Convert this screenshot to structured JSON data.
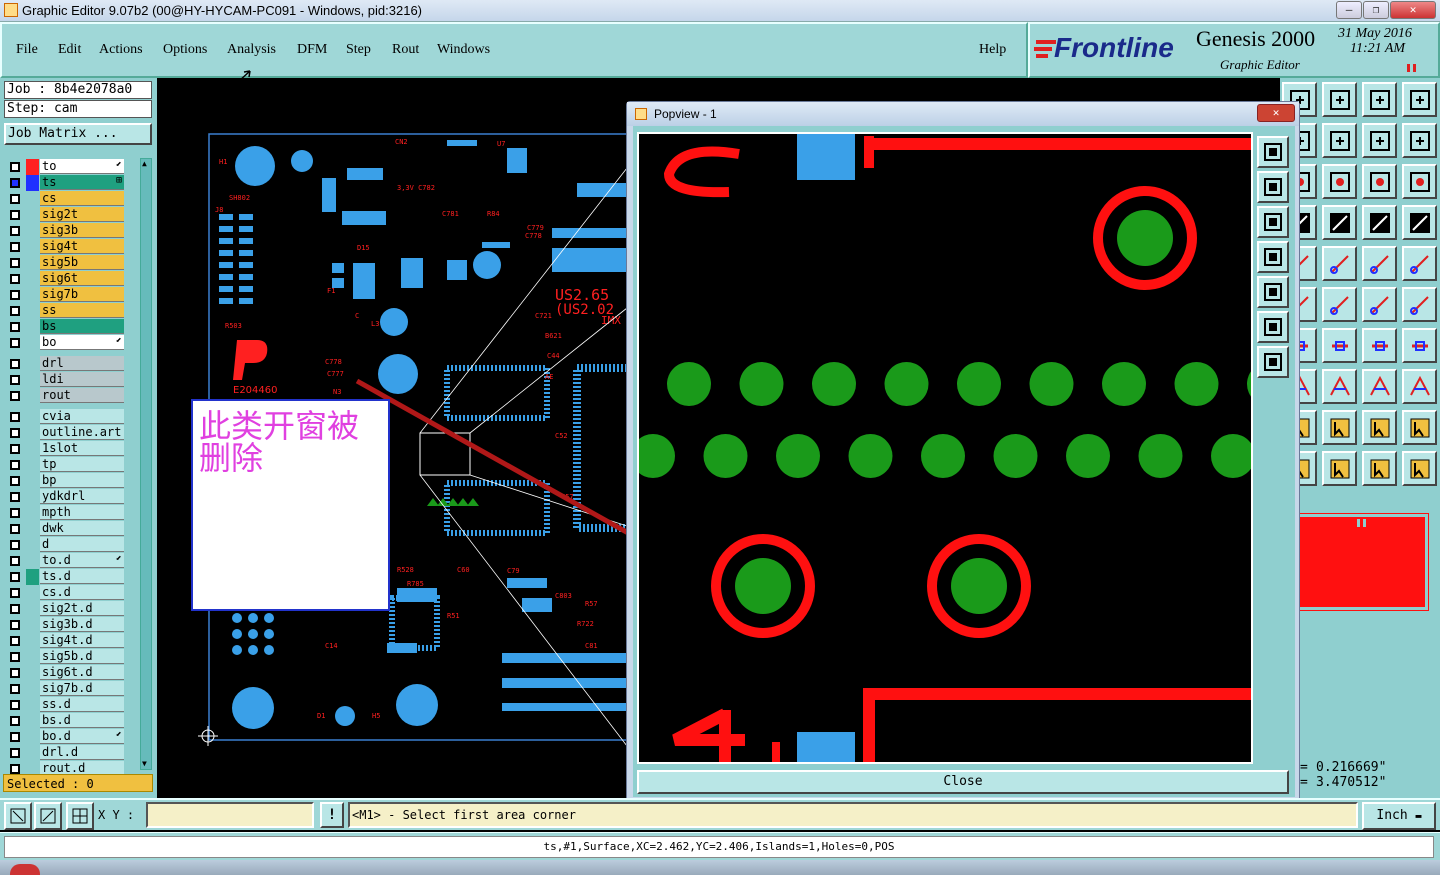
{
  "window": {
    "title": "Graphic Editor 9.07b2 (00@HY-HYCAM-PC091 - Windows, pid:3216)",
    "buttons": [
      "—",
      "❐",
      "✕"
    ]
  },
  "menu": {
    "items": [
      "File",
      "Edit",
      "Actions",
      "Options",
      "Analysis",
      "DFM",
      "Step",
      "Rout",
      "Windows"
    ],
    "help": "Help"
  },
  "brand": {
    "logo": "Frontline",
    "product": "Genesis 2000",
    "subtitle": "Graphic Editor",
    "date": "31 May 2016",
    "time": "11:21 AM"
  },
  "job": {
    "job_label": "Job : 8b4e2078a0",
    "step_label": "Step: cam",
    "matrix_button": "Job Matrix ..."
  },
  "layers_group1": [
    {
      "name": "to",
      "swatch": "#ff2020",
      "bg": "#ffffff",
      "mark": "⬋"
    },
    {
      "name": "ts",
      "swatch": "#2030ff",
      "bg": "#1fa080",
      "mark": "⊞",
      "active": true
    },
    {
      "name": "cs",
      "swatch": "#8fcfcf",
      "bg": "#f0c040"
    },
    {
      "name": "sig2t",
      "swatch": "#8fcfcf",
      "bg": "#f0c040"
    },
    {
      "name": "sig3b",
      "swatch": "#8fcfcf",
      "bg": "#f0c040"
    },
    {
      "name": "sig4t",
      "swatch": "#8fcfcf",
      "bg": "#f0c040"
    },
    {
      "name": "sig5b",
      "swatch": "#8fcfcf",
      "bg": "#f0c040"
    },
    {
      "name": "sig6t",
      "swatch": "#8fcfcf",
      "bg": "#f0c040"
    },
    {
      "name": "sig7b",
      "swatch": "#8fcfcf",
      "bg": "#f0c040"
    },
    {
      "name": "ss",
      "swatch": "#8fcfcf",
      "bg": "#f0c040"
    },
    {
      "name": "bs",
      "swatch": "#8fcfcf",
      "bg": "#1fa080"
    },
    {
      "name": "bo",
      "swatch": "#8fcfcf",
      "bg": "#ffffff",
      "mark": "⬋"
    }
  ],
  "layers_group2": [
    {
      "name": "drl",
      "swatch": "#8fcfcf",
      "bg": "#b8c8cc"
    },
    {
      "name": "ldi",
      "swatch": "#8fcfcf",
      "bg": "#b8c8cc"
    },
    {
      "name": "rout",
      "swatch": "#8fcfcf",
      "bg": "#b8c8cc"
    }
  ],
  "layers_group3": [
    {
      "name": "cvia"
    },
    {
      "name": "outline.art"
    },
    {
      "name": "1slot"
    },
    {
      "name": "tp"
    },
    {
      "name": "bp"
    },
    {
      "name": "ydkdrl"
    },
    {
      "name": "mpth"
    },
    {
      "name": "dwk"
    },
    {
      "name": "d"
    },
    {
      "name": "to.d",
      "mark": "⬋"
    },
    {
      "name": "ts.d",
      "swatch": "#1fa080"
    },
    {
      "name": "cs.d"
    },
    {
      "name": "sig2t.d"
    },
    {
      "name": "sig3b.d"
    },
    {
      "name": "sig4t.d"
    },
    {
      "name": "sig5b.d"
    },
    {
      "name": "sig6t.d"
    },
    {
      "name": "sig7b.d"
    },
    {
      "name": "ss.d"
    },
    {
      "name": "bs.d"
    },
    {
      "name": "bo.d",
      "mark": "⬋"
    },
    {
      "name": "drl.d"
    },
    {
      "name": "rout.d"
    }
  ],
  "selected": "Selected : 0",
  "annotation": {
    "line1": "此类开窗被",
    "line2": "删除"
  },
  "popview": {
    "title": "Popview - 1",
    "close_label": "Close",
    "x_button": "✕"
  },
  "board": {
    "label_E": "E204460",
    "label_US": "US2.65",
    "label_US2": "(US2.02",
    "label_IMX": "IMX"
  },
  "coords": {
    "x": "0.216669\"",
    "y": "3.470512\""
  },
  "bottom": {
    "xy_label": "X Y :",
    "xy_value": "",
    "prompt": "<M1> - Select first area corner",
    "unit": "Inch",
    "excl": "!"
  },
  "status": {
    "text": "ts,#1,Surface,XC=2.462,YC=2.406,Islands=1,Holes=0,POS"
  },
  "colors": {
    "panel": "#8fcfcf",
    "pad_blue": "#3aa0e8",
    "copper_red": "#ff1010",
    "pad_green": "#1a9a1a",
    "highlight_yellow": "#f0c040"
  }
}
